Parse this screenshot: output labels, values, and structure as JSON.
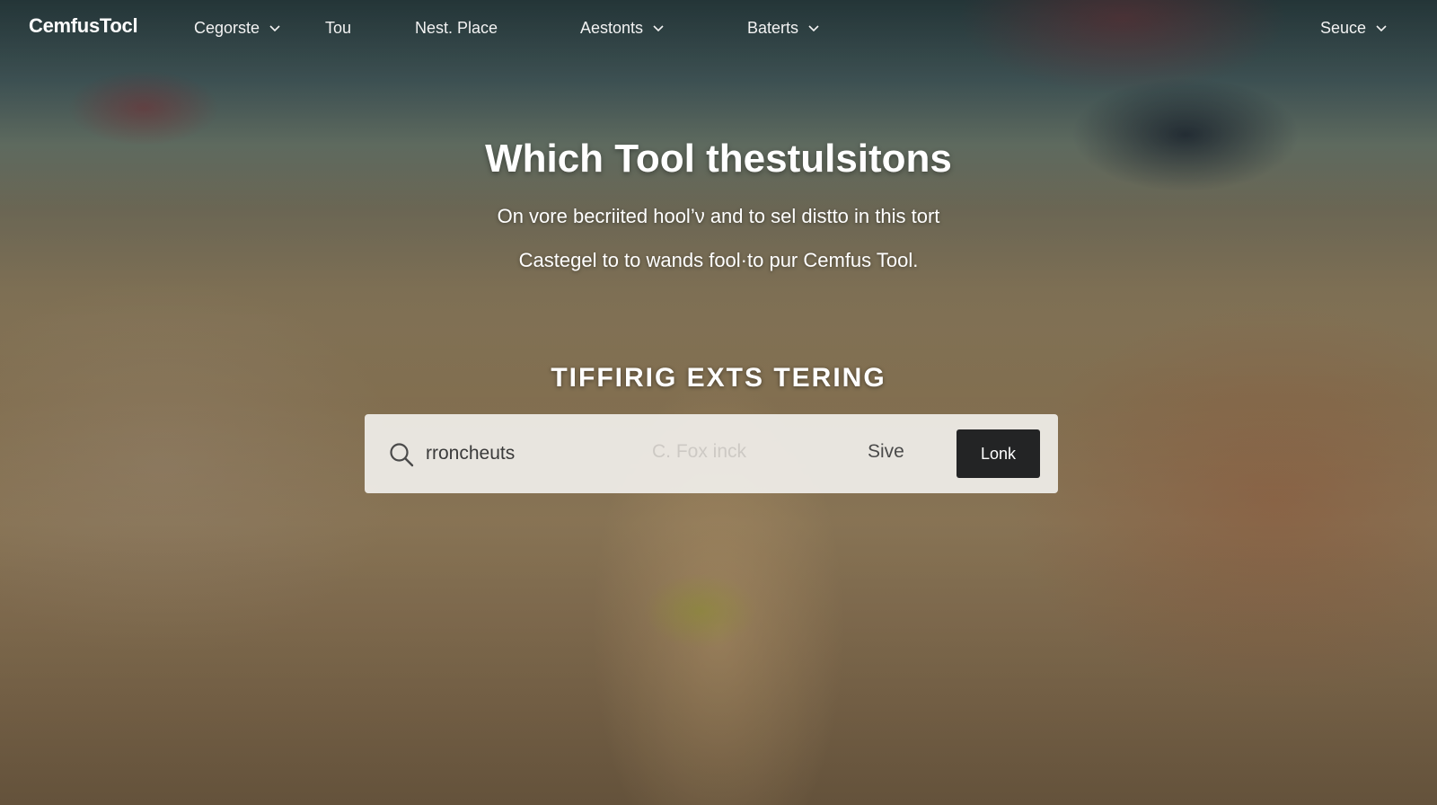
{
  "nav": {
    "logo": "CemfusTocl",
    "items": [
      {
        "label": "Cegorste",
        "has_dropdown": true
      },
      {
        "label": "Tou",
        "has_dropdown": false
      },
      {
        "label": "Nest. Place",
        "has_dropdown": false
      },
      {
        "label": "Aestonts",
        "has_dropdown": true
      },
      {
        "label": "Baterts",
        "has_dropdown": true
      },
      {
        "label": "Seuce",
        "has_dropdown": true
      }
    ],
    "chevron_icon": "chevron-down-icon"
  },
  "hero": {
    "title": "Which Tool thestulsitons",
    "subtitle_1": "On vore becriited hool’ν and to sel distto in this tort",
    "subtitle_2": "Castegel to to wands fool·to pur Cemfus Tool."
  },
  "search_section": {
    "heading": "TIFFIRIG EXTS TERING",
    "search_icon": "search-icon",
    "input_value": "rroncheuts",
    "faded_hint": "C. Fox inck",
    "save_label": "Sive",
    "submit_label": "Lonk"
  },
  "colors": {
    "button_dark": "#232425",
    "panel_bg": "#f0eeea",
    "text_white": "#ffffff"
  }
}
